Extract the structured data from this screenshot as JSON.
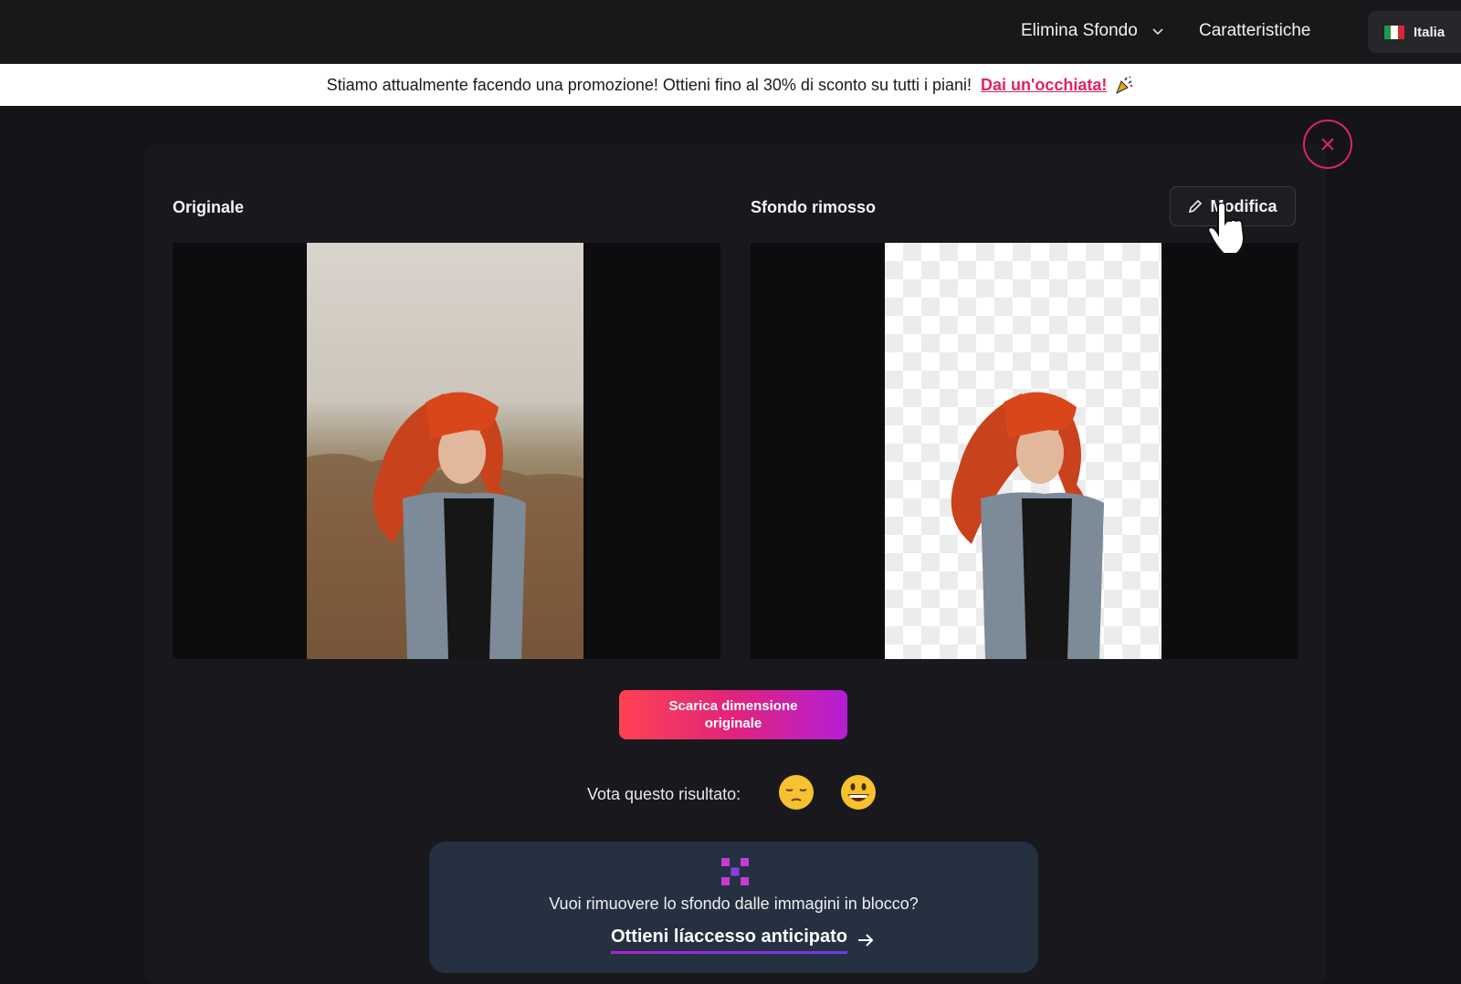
{
  "nav": {
    "elimina_sfondo": "Elimina Sfondo",
    "caratteristiche": "Caratteristiche",
    "language": "Italia"
  },
  "promo": {
    "text": "Stiamo attualmente facendo una promozione! Ottieni fino al 30% di sconto su tutti i piani!",
    "link": "Dai un'occhiata!"
  },
  "result": {
    "original_label": "Originale",
    "removed_label": "Sfondo rimosso",
    "edit_button": "Modifica",
    "download_button": "Scarica dimensione originale",
    "rate_label": "Vota questo risultato:"
  },
  "bulk": {
    "question": "Vuoi rimuovere lo sfondo dalle immagini in blocco?",
    "cta": "Ottieni líaccesso anticipato"
  },
  "colors": {
    "accent": "#e0245e",
    "download_gradient_start": "#ff4252",
    "download_gradient_end": "#b41ed6",
    "card_bg": "#253041"
  },
  "icons": [
    "chevron-down-icon",
    "italy-flag-icon",
    "party-popper-icon",
    "close-icon",
    "pencil-icon",
    "hand-cursor-icon",
    "pensive-face-icon",
    "grinning-face-icon",
    "grid-logo-icon",
    "arrow-right-icon"
  ]
}
